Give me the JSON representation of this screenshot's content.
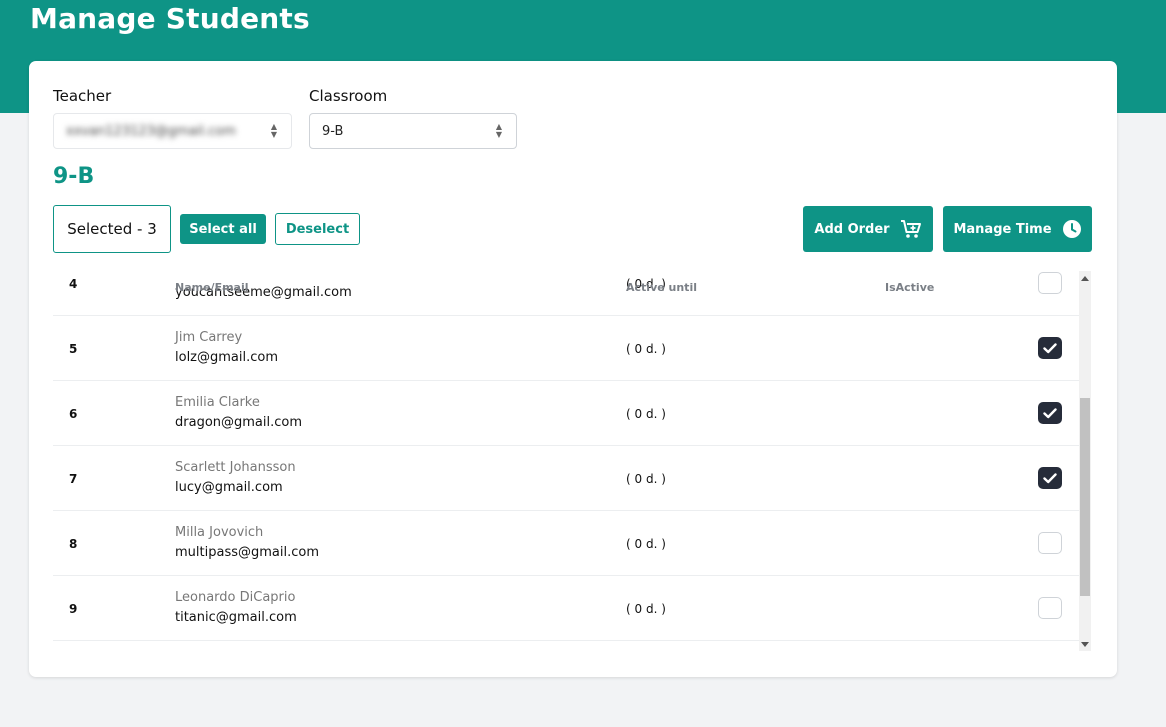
{
  "page": {
    "title": "Manage Students"
  },
  "filters": {
    "teacher_label": "Teacher",
    "teacher_value": "xxvan123123@gmail.com",
    "classroom_label": "Classroom",
    "classroom_value": "9-B"
  },
  "classroom_heading": "9-B",
  "toolbar": {
    "selected_text": "Selected - 3",
    "select_all_label": "Select all",
    "deselect_label": "Deselect",
    "add_order_label": "Add Order",
    "add_order_icon": "cart-plus-icon",
    "manage_time_label": "Manage Time",
    "manage_time_icon": "clock-icon"
  },
  "table": {
    "columns": {
      "name_email": "Name/Email",
      "active_until": "Active until",
      "is_active": "IsActive"
    },
    "rows": [
      {
        "num": "4",
        "name": "",
        "email": "youcantseeme@gmail.com",
        "active_until": "( 0 d. )",
        "checked": false
      },
      {
        "num": "5",
        "name": "Jim Carrey",
        "email": "lolz@gmail.com",
        "active_until": "( 0 d. )",
        "checked": true
      },
      {
        "num": "6",
        "name": "Emilia Clarke",
        "email": "dragon@gmail.com",
        "active_until": "( 0 d. )",
        "checked": true
      },
      {
        "num": "7",
        "name": "Scarlett Johansson",
        "email": "lucy@gmail.com",
        "active_until": "( 0 d. )",
        "checked": true
      },
      {
        "num": "8",
        "name": "Milla Jovovich",
        "email": "multipass@gmail.com",
        "active_until": "( 0 d. )",
        "checked": false
      },
      {
        "num": "9",
        "name": "Leonardo DiCaprio",
        "email": "titanic@gmail.com",
        "active_until": "( 0 d. )",
        "checked": false
      }
    ]
  },
  "colors": {
    "brand": "#0e9486",
    "checkbox_checked": "#262c3a",
    "page_bg": "#f2f3f5"
  }
}
